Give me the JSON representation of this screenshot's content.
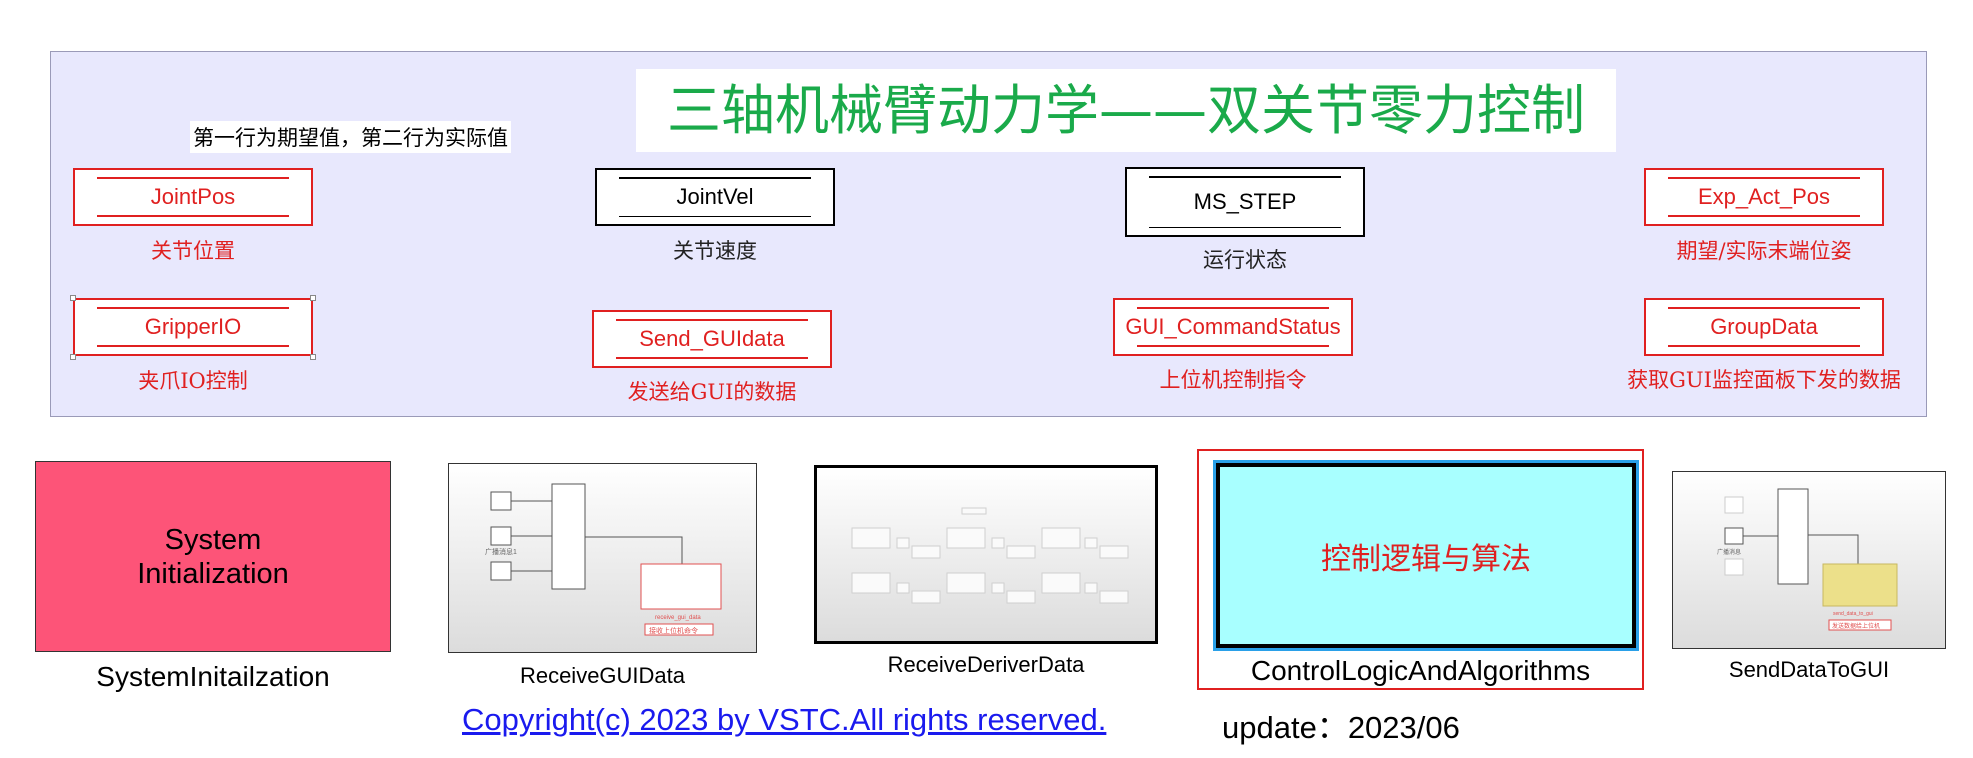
{
  "title": "三轴机械臂动力学——双关节零力控制",
  "note": "第一行为期望值，第二行为实际值",
  "blocks": {
    "joint_pos": {
      "label": "JointPos",
      "caption": "关节位置"
    },
    "joint_vel": {
      "label": "JointVel",
      "caption": "关节速度"
    },
    "ms_step": {
      "label": "MS_STEP",
      "caption": "运行状态"
    },
    "exp_act_pos": {
      "label": "Exp_Act_Pos",
      "caption": "期望/实际末端位姿"
    },
    "gripper_io": {
      "label": "GripperIO",
      "caption": "夹爪IO控制"
    },
    "send_gui_data": {
      "label": "Send_GUIdata",
      "caption": "发送给GUI的数据"
    },
    "gui_command_status": {
      "label": "GUI_CommandStatus",
      "caption": "上位机控制指令"
    },
    "group_data": {
      "label": "GroupData",
      "caption": "获取GUI监控面板下发的数据"
    }
  },
  "subsystems": {
    "system_init": {
      "label_line1": "System",
      "label_line2": "Initialization",
      "caption": "SystemInitailzation",
      "color": "#fd5478"
    },
    "receive_gui": {
      "caption": "ReceiveGUIData",
      "thumb_text_1": "广播消息1",
      "thumb_text_2": "receive_gui_data",
      "thumb_text_3": "接收上位机命令"
    },
    "receive_driver": {
      "caption": "ReceiveDeriverData"
    },
    "control_logic": {
      "label": "控制逻辑与算法",
      "caption": "ControlLogicAndAlgorithms",
      "color": "#a8ffff"
    },
    "send_gui": {
      "caption": "SendDataToGUI",
      "thumb_text_1": "广播消息",
      "thumb_text_2": "send_data_to_gui",
      "thumb_text_3": "发送数据给上位机"
    }
  },
  "footer": {
    "copyright": "Copyright(c) 2023 by VSTC.All rights reserved.",
    "update": "update：2023/06"
  },
  "colors": {
    "panel_bg": "#e8e8fd",
    "title_green": "#1aaa4a",
    "red": "#e02020",
    "link_blue": "#1a1aee"
  }
}
